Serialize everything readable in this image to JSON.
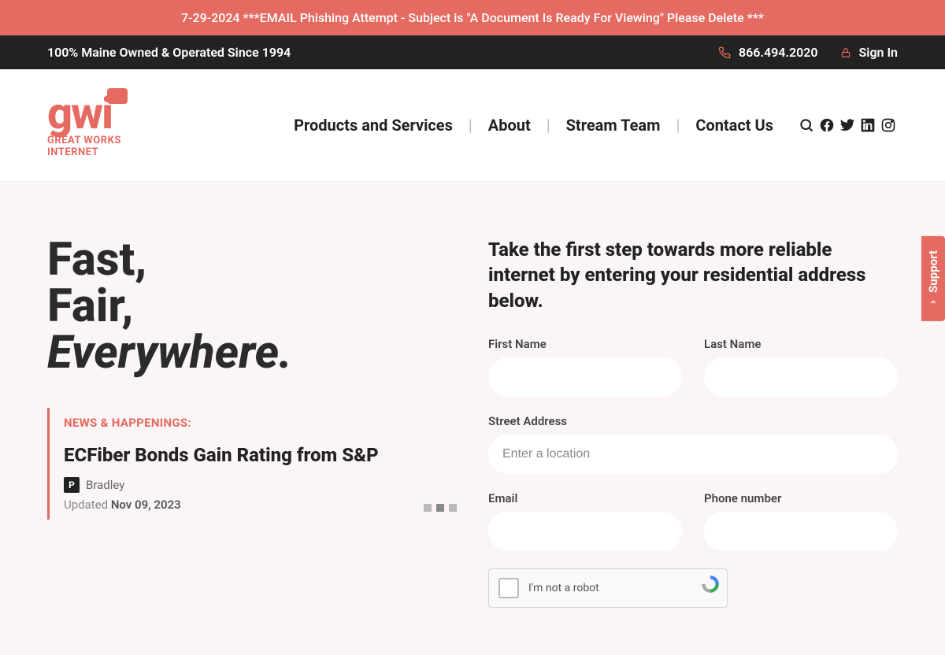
{
  "colors": {
    "accent": "#e56a61"
  },
  "announcement": "7-29-2024 ***EMAIL Phishing Attempt - Subject is \"A Document Is Ready For Viewing\" Please Delete ***",
  "utilbar": {
    "tagline": "100% Maine Owned & Operated Since 1994",
    "phone": "866.494.2020",
    "sign_in": "Sign In"
  },
  "logo": {
    "main": "gwi",
    "tagline1": "GREAT WORKS",
    "tagline2": "INTERNET"
  },
  "nav": {
    "items": [
      "Products and Services",
      "About",
      "Stream Team",
      "Contact Us"
    ]
  },
  "hero": {
    "line1": "Fast,",
    "line2": "Fair,",
    "line3": "Everywhere."
  },
  "news": {
    "label": "NEWS & HAPPENINGS:",
    "headline": "ECFiber Bonds Gain Rating from S&P",
    "author_initial": "P",
    "author": "Bradley",
    "updated_prefix": "Updated ",
    "updated_date": "Nov 09, 2023",
    "active_dot": 1,
    "dot_count": 3
  },
  "form": {
    "intro": "Take the first step towards more reliable internet by entering your residential address below.",
    "first_name_label": "First Name",
    "last_name_label": "Last Name",
    "street_label": "Street Address",
    "street_placeholder": "Enter a location",
    "email_label": "Email",
    "phone_label": "Phone number",
    "recaptcha_label": "I'm not a robot"
  },
  "support_tab": "Support"
}
